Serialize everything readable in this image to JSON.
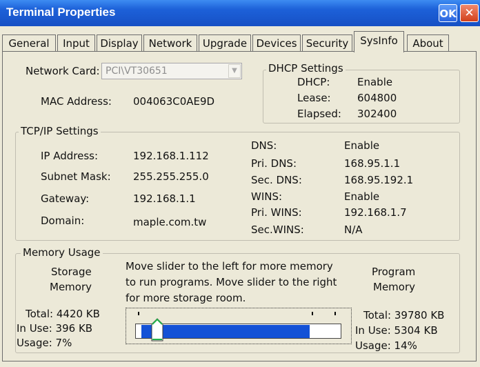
{
  "window": {
    "title": "Terminal Properties",
    "ok_label": "OK",
    "close_label": "✕"
  },
  "tabs": [
    "General",
    "Input",
    "Display",
    "Network",
    "Upgrade",
    "Devices",
    "Security",
    "SysInfo",
    "About"
  ],
  "active_tab": "SysInfo",
  "network_card": {
    "label": "Network Card:",
    "value": "PCI\\VT30651",
    "mac_label": "MAC Address:",
    "mac_value": "004063C0AE9D"
  },
  "dhcp": {
    "title": "DHCP Settings",
    "dhcp_label": "DHCP:",
    "dhcp_value": "Enable",
    "lease_label": "Lease:",
    "lease_value": "604800",
    "elapsed_label": "Elapsed:",
    "elapsed_value": "302400"
  },
  "tcpip": {
    "title": "TCP/IP Settings",
    "ip_label": "IP Address:",
    "ip_value": "192.168.1.112",
    "mask_label": "Subnet Mask:",
    "mask_value": "255.255.255.0",
    "gw_label": "Gateway:",
    "gw_value": "192.168.1.1",
    "domain_label": "Domain:",
    "domain_value": "maple.com.tw",
    "dns_label": "DNS:",
    "dns_value": "Enable",
    "pri_dns_label": "Pri. DNS:",
    "pri_dns_value": "168.95.1.1",
    "sec_dns_label": "Sec. DNS:",
    "sec_dns_value": "168.95.192.1",
    "wins_label": "WINS:",
    "wins_value": "Enable",
    "pri_wins_label": "Pri. WINS:",
    "pri_wins_value": "192.168.1.7",
    "sec_wins_label": "Sec.WINS:",
    "sec_wins_value": "N/A"
  },
  "memory": {
    "title": "Memory Usage",
    "storage_title_1": "Storage",
    "storage_title_2": "Memory",
    "program_title_1": "Program",
    "program_title_2": "Memory",
    "instructions_1": "Move slider to the left for more memory",
    "instructions_2": "to run programs. Move slider to the right",
    "instructions_3": "for more storage room.",
    "storage_total": "Total:  4420 KB",
    "storage_inuse": "In Use:  396 KB",
    "storage_usage": "Usage:  7%",
    "program_total": "Total:  39780 KB",
    "program_inuse": "In Use:  5304 KB",
    "program_usage": "Usage:  14%",
    "slider_storage_fraction": 0.1
  },
  "icons": {
    "ok": "ok-icon",
    "close": "close-icon",
    "combo_arrow": "chevron-down-icon"
  }
}
